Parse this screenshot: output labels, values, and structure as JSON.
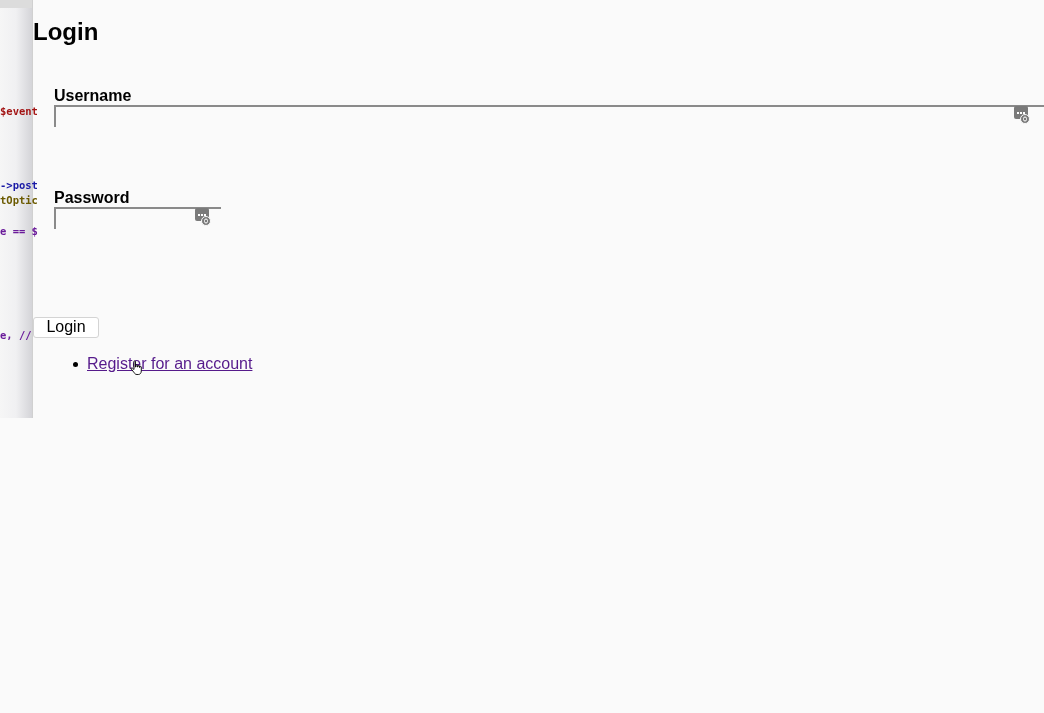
{
  "background_editor": {
    "lines": [
      {
        "text": "$event",
        "color": "#a31515"
      },
      {
        "text": "->post",
        "color": "#1a1aa6"
      },
      {
        "text": "tOptic",
        "color": "#6b5a00"
      },
      {
        "text": "e == $",
        "color": "#6a1b9a"
      },
      {
        "text": "e, //",
        "color": "#6a1b9a"
      }
    ]
  },
  "heading": "Login",
  "fields": [
    {
      "label": "Username",
      "wide": true
    },
    {
      "label": "Password",
      "wide": false
    }
  ],
  "button": "Login",
  "links": [
    "Register for an account"
  ]
}
